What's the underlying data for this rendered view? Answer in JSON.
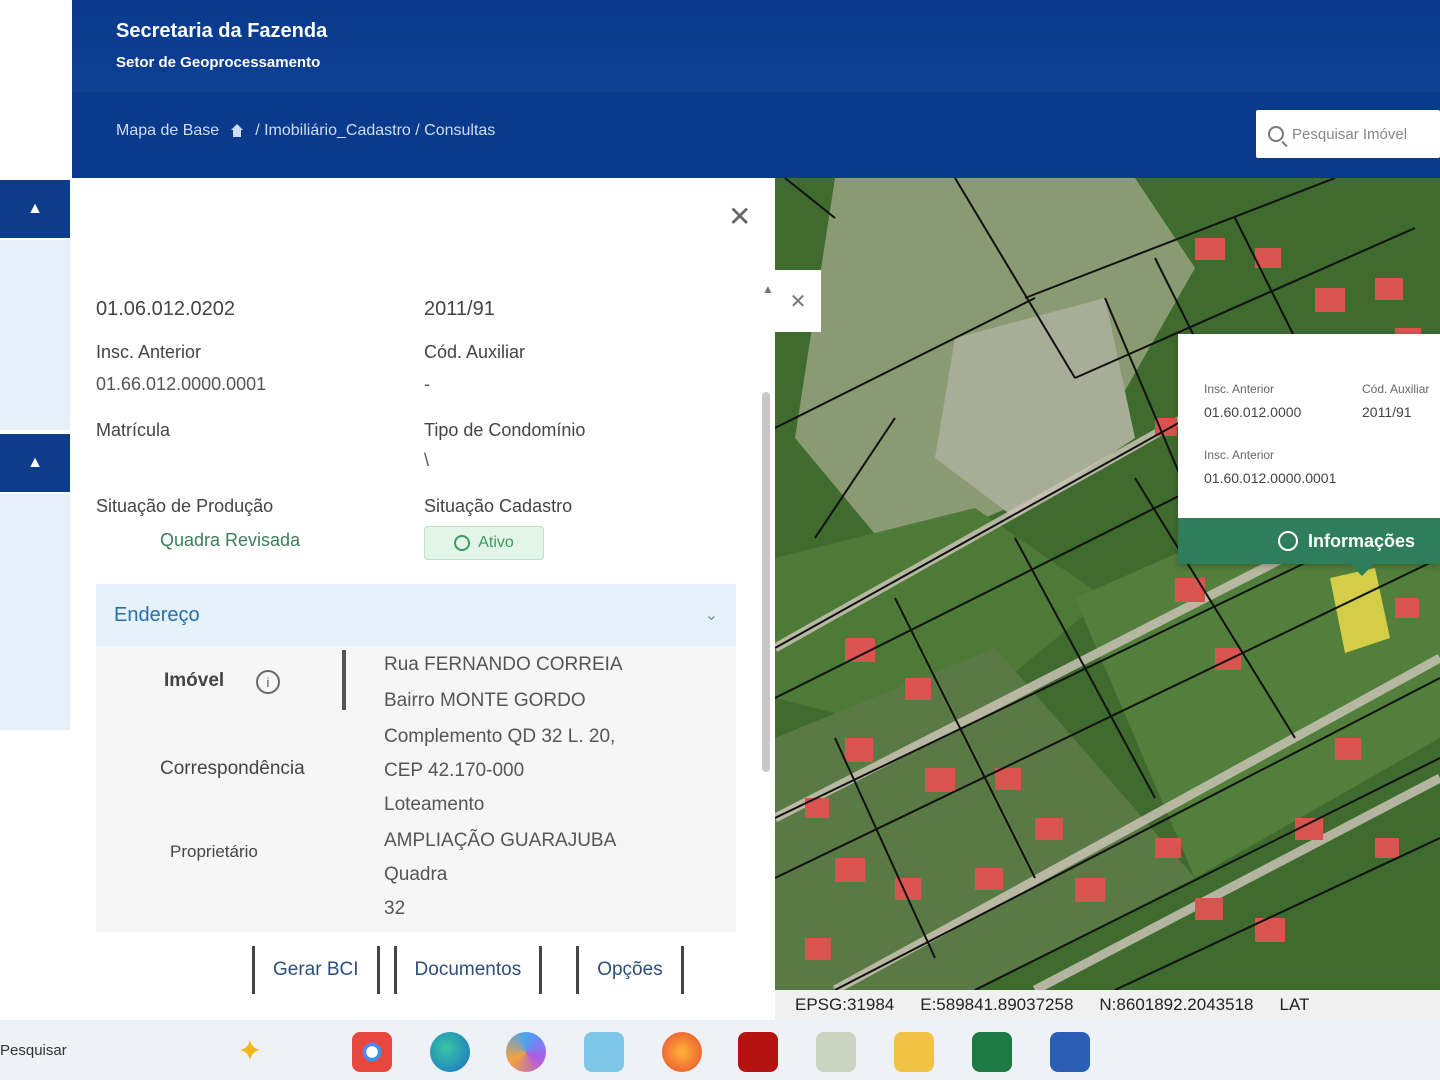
{
  "header": {
    "title": "Secretaria da Fazenda",
    "subtitle": "Setor de Geoprocessamento",
    "breadcrumb_start": "Mapa de Base",
    "breadcrumb_path": "/ Imobiliário_Cadastro / Consultas",
    "search_placeholder": "Pesquisar Imóvel"
  },
  "panel": {
    "inscricao": "01.06.012.0202",
    "ano": "2011/91",
    "insc_anterior_label": "Insc. Anterior",
    "insc_anterior_value": "01.66.012.0000.0001",
    "cod_auxiliar_label": "Cód. Auxiliar",
    "cod_auxiliar_value": "-",
    "matricula_label": "Matrícula",
    "tipo_condominio_label": "Tipo de Condomínio",
    "tipo_condominio_value": "\\",
    "situacao_producao_label": "Situação de Produção",
    "situacao_producao_value": "Quadra Revisada",
    "situacao_cadastro_label": "Situação Cadastro",
    "situacao_cadastro_value": "Ativo",
    "accordion_title": "Endereço",
    "acc_imovel_label": "Imóvel",
    "acc_correspondencia_label": "Correspondência",
    "acc_proprietario_label": "Proprietário",
    "address_lines": [
      "Rua FERNANDO CORREIA",
      "Bairro MONTE GORDO",
      "Complemento QD 32 L. 20,",
      "CEP 42.170-000",
      "Loteamento",
      "AMPLIAÇÃO GUARAJUBA",
      "Quadra",
      "32"
    ],
    "buttons": [
      "Gerar BCI",
      "Documentos",
      "Opções"
    ]
  },
  "map": {
    "popup": {
      "insc_anterior_label": "Insc. Anterior",
      "insc_anterior_value": "01.60.012.0000",
      "cod_auxiliar_label": "Cód. Auxiliar",
      "cod_auxiliar_value": "2011/91",
      "insc_anterior2_label": "Insc. Anterior",
      "insc_anterior2_value": "01.60.012.0000.0001",
      "button_label": "Informações"
    },
    "coords": {
      "epsg": "EPSG:31984",
      "e": "E:589841.89037258",
      "n": "N:8601892.2043518",
      "lat": "LAT"
    }
  },
  "taskbar": {
    "search_text": "Pesquisar",
    "apps": [
      "copilot-icon",
      "chrome-icon",
      "edge-icon",
      "copilot-app-icon",
      "photos-icon",
      "firefox-icon",
      "acrobat-icon",
      "tools-icon",
      "files-icon",
      "excel-icon",
      "word-icon"
    ]
  }
}
